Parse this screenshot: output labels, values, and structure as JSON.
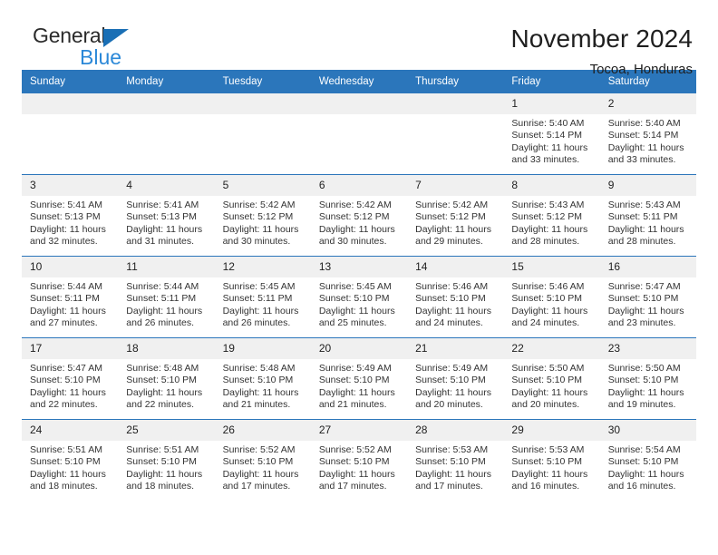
{
  "brand": {
    "name_top": "General",
    "name_bottom": "Blue",
    "triangle_color": "#1a6fb5",
    "blue_color": "#2b88d8"
  },
  "header": {
    "title": "November 2024",
    "subtitle": "Tocoa, Honduras"
  },
  "theme": {
    "header_blue": "#2b76bb",
    "daynum_band": "#f0f0f0",
    "text": "#333333"
  },
  "calendar": {
    "weekday_headers": [
      "Sunday",
      "Monday",
      "Tuesday",
      "Wednesday",
      "Thursday",
      "Friday",
      "Saturday"
    ],
    "weeks": [
      [
        {
          "day": "",
          "blank": true,
          "sunrise": "",
          "sunset": "",
          "daylight_1": "",
          "daylight_2": ""
        },
        {
          "day": "",
          "blank": true,
          "sunrise": "",
          "sunset": "",
          "daylight_1": "",
          "daylight_2": ""
        },
        {
          "day": "",
          "blank": true,
          "sunrise": "",
          "sunset": "",
          "daylight_1": "",
          "daylight_2": ""
        },
        {
          "day": "",
          "blank": true,
          "sunrise": "",
          "sunset": "",
          "daylight_1": "",
          "daylight_2": ""
        },
        {
          "day": "",
          "blank": true,
          "sunrise": "",
          "sunset": "",
          "daylight_1": "",
          "daylight_2": ""
        },
        {
          "day": "1",
          "blank": false,
          "sunrise": "Sunrise: 5:40 AM",
          "sunset": "Sunset: 5:14 PM",
          "daylight_1": "Daylight: 11 hours",
          "daylight_2": "and 33 minutes."
        },
        {
          "day": "2",
          "blank": false,
          "sunrise": "Sunrise: 5:40 AM",
          "sunset": "Sunset: 5:14 PM",
          "daylight_1": "Daylight: 11 hours",
          "daylight_2": "and 33 minutes."
        }
      ],
      [
        {
          "day": "3",
          "blank": false,
          "sunrise": "Sunrise: 5:41 AM",
          "sunset": "Sunset: 5:13 PM",
          "daylight_1": "Daylight: 11 hours",
          "daylight_2": "and 32 minutes."
        },
        {
          "day": "4",
          "blank": false,
          "sunrise": "Sunrise: 5:41 AM",
          "sunset": "Sunset: 5:13 PM",
          "daylight_1": "Daylight: 11 hours",
          "daylight_2": "and 31 minutes."
        },
        {
          "day": "5",
          "blank": false,
          "sunrise": "Sunrise: 5:42 AM",
          "sunset": "Sunset: 5:12 PM",
          "daylight_1": "Daylight: 11 hours",
          "daylight_2": "and 30 minutes."
        },
        {
          "day": "6",
          "blank": false,
          "sunrise": "Sunrise: 5:42 AM",
          "sunset": "Sunset: 5:12 PM",
          "daylight_1": "Daylight: 11 hours",
          "daylight_2": "and 30 minutes."
        },
        {
          "day": "7",
          "blank": false,
          "sunrise": "Sunrise: 5:42 AM",
          "sunset": "Sunset: 5:12 PM",
          "daylight_1": "Daylight: 11 hours",
          "daylight_2": "and 29 minutes."
        },
        {
          "day": "8",
          "blank": false,
          "sunrise": "Sunrise: 5:43 AM",
          "sunset": "Sunset: 5:12 PM",
          "daylight_1": "Daylight: 11 hours",
          "daylight_2": "and 28 minutes."
        },
        {
          "day": "9",
          "blank": false,
          "sunrise": "Sunrise: 5:43 AM",
          "sunset": "Sunset: 5:11 PM",
          "daylight_1": "Daylight: 11 hours",
          "daylight_2": "and 28 minutes."
        }
      ],
      [
        {
          "day": "10",
          "blank": false,
          "sunrise": "Sunrise: 5:44 AM",
          "sunset": "Sunset: 5:11 PM",
          "daylight_1": "Daylight: 11 hours",
          "daylight_2": "and 27 minutes."
        },
        {
          "day": "11",
          "blank": false,
          "sunrise": "Sunrise: 5:44 AM",
          "sunset": "Sunset: 5:11 PM",
          "daylight_1": "Daylight: 11 hours",
          "daylight_2": "and 26 minutes."
        },
        {
          "day": "12",
          "blank": false,
          "sunrise": "Sunrise: 5:45 AM",
          "sunset": "Sunset: 5:11 PM",
          "daylight_1": "Daylight: 11 hours",
          "daylight_2": "and 26 minutes."
        },
        {
          "day": "13",
          "blank": false,
          "sunrise": "Sunrise: 5:45 AM",
          "sunset": "Sunset: 5:10 PM",
          "daylight_1": "Daylight: 11 hours",
          "daylight_2": "and 25 minutes."
        },
        {
          "day": "14",
          "blank": false,
          "sunrise": "Sunrise: 5:46 AM",
          "sunset": "Sunset: 5:10 PM",
          "daylight_1": "Daylight: 11 hours",
          "daylight_2": "and 24 minutes."
        },
        {
          "day": "15",
          "blank": false,
          "sunrise": "Sunrise: 5:46 AM",
          "sunset": "Sunset: 5:10 PM",
          "daylight_1": "Daylight: 11 hours",
          "daylight_2": "and 24 minutes."
        },
        {
          "day": "16",
          "blank": false,
          "sunrise": "Sunrise: 5:47 AM",
          "sunset": "Sunset: 5:10 PM",
          "daylight_1": "Daylight: 11 hours",
          "daylight_2": "and 23 minutes."
        }
      ],
      [
        {
          "day": "17",
          "blank": false,
          "sunrise": "Sunrise: 5:47 AM",
          "sunset": "Sunset: 5:10 PM",
          "daylight_1": "Daylight: 11 hours",
          "daylight_2": "and 22 minutes."
        },
        {
          "day": "18",
          "blank": false,
          "sunrise": "Sunrise: 5:48 AM",
          "sunset": "Sunset: 5:10 PM",
          "daylight_1": "Daylight: 11 hours",
          "daylight_2": "and 22 minutes."
        },
        {
          "day": "19",
          "blank": false,
          "sunrise": "Sunrise: 5:48 AM",
          "sunset": "Sunset: 5:10 PM",
          "daylight_1": "Daylight: 11 hours",
          "daylight_2": "and 21 minutes."
        },
        {
          "day": "20",
          "blank": false,
          "sunrise": "Sunrise: 5:49 AM",
          "sunset": "Sunset: 5:10 PM",
          "daylight_1": "Daylight: 11 hours",
          "daylight_2": "and 21 minutes."
        },
        {
          "day": "21",
          "blank": false,
          "sunrise": "Sunrise: 5:49 AM",
          "sunset": "Sunset: 5:10 PM",
          "daylight_1": "Daylight: 11 hours",
          "daylight_2": "and 20 minutes."
        },
        {
          "day": "22",
          "blank": false,
          "sunrise": "Sunrise: 5:50 AM",
          "sunset": "Sunset: 5:10 PM",
          "daylight_1": "Daylight: 11 hours",
          "daylight_2": "and 20 minutes."
        },
        {
          "day": "23",
          "blank": false,
          "sunrise": "Sunrise: 5:50 AM",
          "sunset": "Sunset: 5:10 PM",
          "daylight_1": "Daylight: 11 hours",
          "daylight_2": "and 19 minutes."
        }
      ],
      [
        {
          "day": "24",
          "blank": false,
          "sunrise": "Sunrise: 5:51 AM",
          "sunset": "Sunset: 5:10 PM",
          "daylight_1": "Daylight: 11 hours",
          "daylight_2": "and 18 minutes."
        },
        {
          "day": "25",
          "blank": false,
          "sunrise": "Sunrise: 5:51 AM",
          "sunset": "Sunset: 5:10 PM",
          "daylight_1": "Daylight: 11 hours",
          "daylight_2": "and 18 minutes."
        },
        {
          "day": "26",
          "blank": false,
          "sunrise": "Sunrise: 5:52 AM",
          "sunset": "Sunset: 5:10 PM",
          "daylight_1": "Daylight: 11 hours",
          "daylight_2": "and 17 minutes."
        },
        {
          "day": "27",
          "blank": false,
          "sunrise": "Sunrise: 5:52 AM",
          "sunset": "Sunset: 5:10 PM",
          "daylight_1": "Daylight: 11 hours",
          "daylight_2": "and 17 minutes."
        },
        {
          "day": "28",
          "blank": false,
          "sunrise": "Sunrise: 5:53 AM",
          "sunset": "Sunset: 5:10 PM",
          "daylight_1": "Daylight: 11 hours",
          "daylight_2": "and 17 minutes."
        },
        {
          "day": "29",
          "blank": false,
          "sunrise": "Sunrise: 5:53 AM",
          "sunset": "Sunset: 5:10 PM",
          "daylight_1": "Daylight: 11 hours",
          "daylight_2": "and 16 minutes."
        },
        {
          "day": "30",
          "blank": false,
          "sunrise": "Sunrise: 5:54 AM",
          "sunset": "Sunset: 5:10 PM",
          "daylight_1": "Daylight: 11 hours",
          "daylight_2": "and 16 minutes."
        }
      ]
    ]
  }
}
